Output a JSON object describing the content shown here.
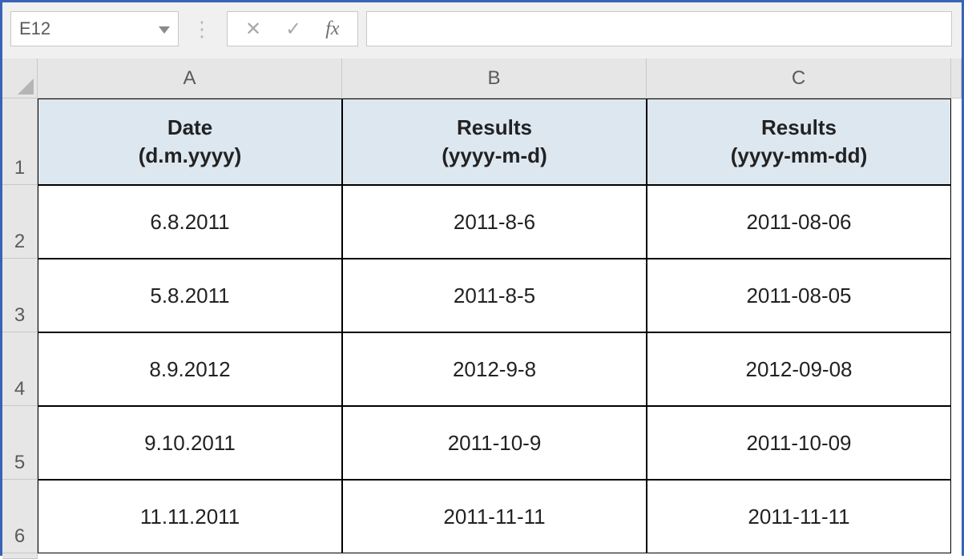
{
  "formula_bar": {
    "name_box": "E12",
    "cancel_icon": "✕",
    "enter_icon": "✓",
    "fx_label": "fx",
    "formula_value": ""
  },
  "columns": {
    "A": "A",
    "B": "B",
    "C": "C"
  },
  "rows": {
    "1": "1",
    "2": "2",
    "3": "3",
    "4": "4",
    "5": "5",
    "6": "6"
  },
  "table": {
    "headers": {
      "A": {
        "line1": "Date",
        "line2": "(d.m.yyyy)"
      },
      "B": {
        "line1": "Results",
        "line2": "(yyyy-m-d)"
      },
      "C": {
        "line1": "Results",
        "line2": "(yyyy-mm-dd)"
      }
    },
    "rows": [
      {
        "date": "6.8.2011",
        "r1": "2011-8-6",
        "r2": "2011-08-06"
      },
      {
        "date": "5.8.2011",
        "r1": "2011-8-5",
        "r2": "2011-08-05"
      },
      {
        "date": "8.9.2012",
        "r1": "2012-9-8",
        "r2": "2012-09-08"
      },
      {
        "date": "9.10.2011",
        "r1": "2011-10-9",
        "r2": "2011-10-09"
      },
      {
        "date": "11.11.2011",
        "r1": "2011-11-11",
        "r2": "2011-11-11"
      }
    ]
  }
}
